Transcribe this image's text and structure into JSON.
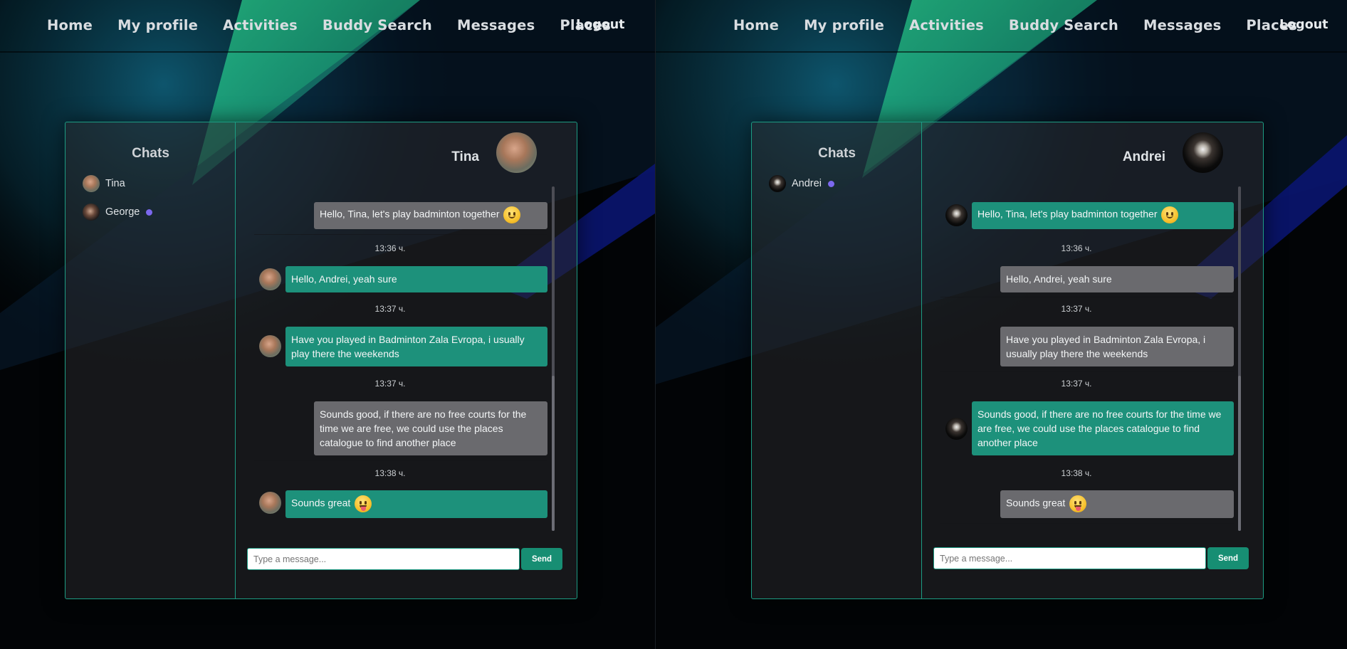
{
  "nav": {
    "items": [
      "Home",
      "My profile",
      "Activities",
      "Buddy Search",
      "Messages",
      "Places"
    ],
    "logout": "Logout"
  },
  "colors": {
    "accent": "#1c9c83",
    "bubble_green": "#1d917b",
    "bubble_grey": "#6a6a6e",
    "online_dot": "#7b68ee",
    "send_button": "#178e73"
  },
  "left": {
    "sidebar_title": "Chats",
    "chats": [
      {
        "name": "Tina",
        "avatar": "tina-avatar",
        "online": false
      },
      {
        "name": "George",
        "avatar": "george-avatar",
        "online": true
      }
    ],
    "header_name": "Tina",
    "messages": [
      {
        "text": "Hello, Tina, let's play badminton together",
        "emoji": "slightly-smiling-face",
        "side": "sent",
        "time": ""
      },
      {
        "text": "Hello, Andrei, yeah sure",
        "emoji": "",
        "side": "received",
        "time": "13:36 ч."
      },
      {
        "text": "Have you played in Badminton Zala Evropa, i usually play there the weekends",
        "emoji": "",
        "side": "received",
        "time": "13:37 ч."
      },
      {
        "text": "Sounds good, if there are no free courts for the time we are free, we could use the places catalogue to find another place",
        "emoji": "",
        "side": "sent",
        "time": "13:37 ч."
      },
      {
        "text": "Sounds great",
        "emoji": "face-with-tongue",
        "side": "received",
        "time": "13:38 ч."
      }
    ],
    "input_placeholder": "Type a message...",
    "send_label": "Send"
  },
  "right": {
    "sidebar_title": "Chats",
    "chats": [
      {
        "name": "Andrei",
        "avatar": "andrei-avatar",
        "online": true
      }
    ],
    "header_name": "Andrei",
    "messages": [
      {
        "text": "Hello, Tina, let's play badminton together",
        "emoji": "slightly-smiling-face",
        "side": "received",
        "time": ""
      },
      {
        "text": "Hello, Andrei, yeah sure",
        "emoji": "",
        "side": "sent",
        "time": "13:36 ч."
      },
      {
        "text": "Have you played in Badminton Zala Evropa, i usually play there the weekends",
        "emoji": "",
        "side": "sent",
        "time": "13:37 ч."
      },
      {
        "text": "Sounds good, if there are no free courts for the time we are free, we could use the places catalogue to find another place",
        "emoji": "",
        "side": "received",
        "time": "13:37 ч."
      },
      {
        "text": "Sounds great",
        "emoji": "face-with-tongue",
        "side": "sent",
        "time": "13:38 ч."
      }
    ],
    "input_placeholder": "Type a message...",
    "send_label": "Send"
  }
}
